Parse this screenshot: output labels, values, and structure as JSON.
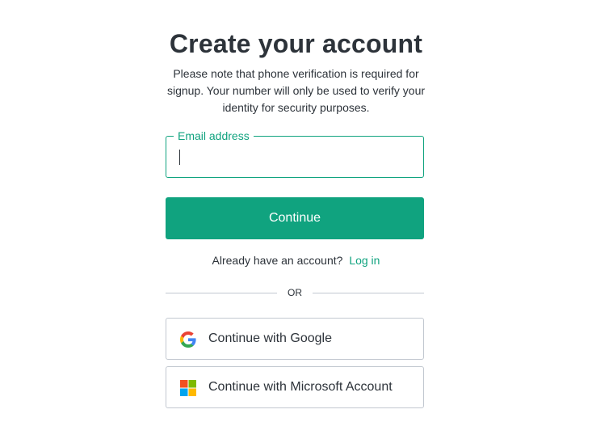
{
  "header": {
    "title": "Create your account",
    "subtitle": "Please note that phone verification is required for signup. Your number will only be used to verify your identity for security purposes."
  },
  "email_field": {
    "label": "Email address",
    "value": "",
    "placeholder": ""
  },
  "continue_button": {
    "label": "Continue"
  },
  "login": {
    "prompt": "Already have an account?",
    "link_label": "Log in"
  },
  "divider": {
    "label": "OR"
  },
  "social": {
    "google_label": "Continue with Google",
    "microsoft_label": "Continue with Microsoft Account"
  },
  "icons": {
    "google": "google-logo-icon",
    "microsoft": "microsoft-logo-icon"
  },
  "colors": {
    "accent": "#10a37f",
    "text": "#2d333a",
    "border": "#c2c8d0",
    "background": "#ffffff"
  }
}
